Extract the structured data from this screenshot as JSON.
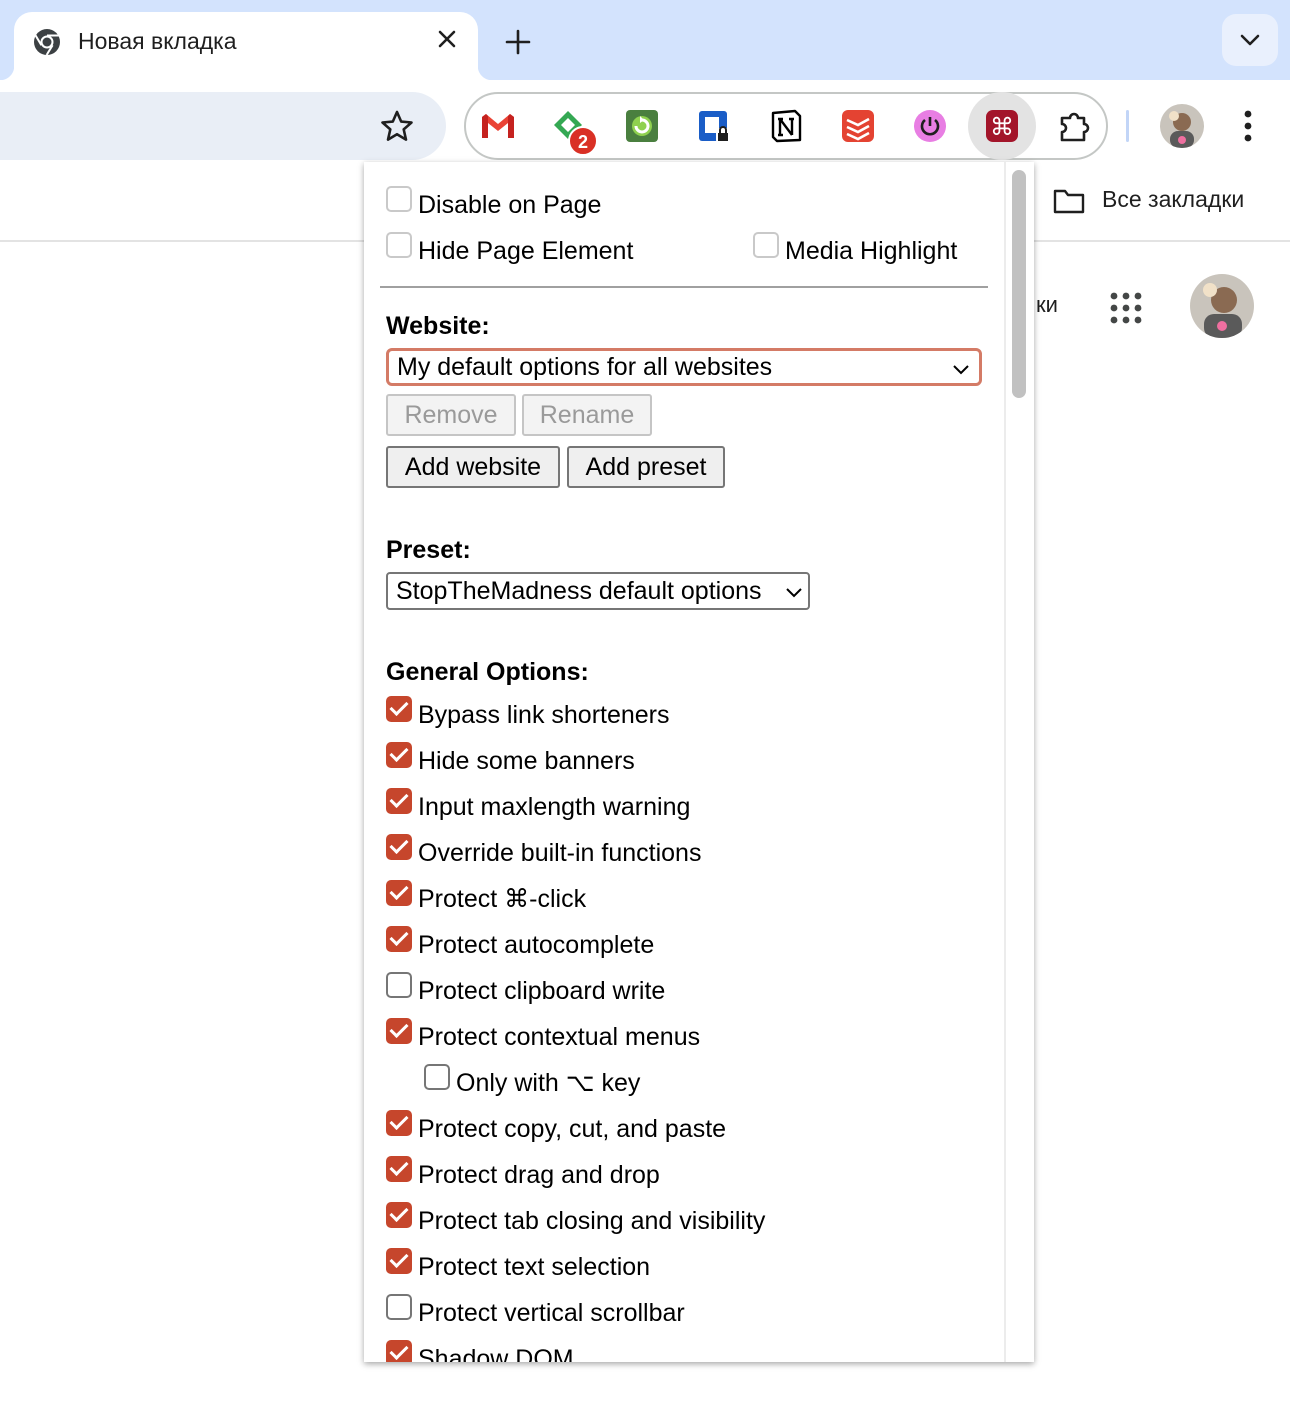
{
  "tab": {
    "title": "Новая вкладка"
  },
  "bookmarks": {
    "all_label": "Все закладки"
  },
  "page": {
    "partial_text": "ки"
  },
  "extensions": {
    "badge_count": "2"
  },
  "popup": {
    "disable_on_page": "Disable on Page",
    "hide_page_element": "Hide Page Element",
    "media_highlight": "Media Highlight",
    "website_heading": "Website:",
    "website_selected": "My default options for all websites",
    "remove_label": "Remove",
    "rename_label": "Rename",
    "add_website_label": "Add website",
    "add_preset_label": "Add preset",
    "preset_heading": "Preset:",
    "preset_selected": "StopTheMadness default options",
    "general_heading": "General Options:",
    "options": [
      {
        "label": "Bypass link shorteners",
        "checked": true
      },
      {
        "label": "Hide some banners",
        "checked": true
      },
      {
        "label": "Input maxlength warning",
        "checked": true
      },
      {
        "label": "Override built-in functions",
        "checked": true
      },
      {
        "label": "Protect ⌘-click",
        "checked": true
      },
      {
        "label": "Protect autocomplete",
        "checked": true
      },
      {
        "label": "Protect clipboard write",
        "checked": false
      },
      {
        "label": "Protect contextual menus",
        "checked": true
      },
      {
        "label": "Only with ⌥ key",
        "checked": false,
        "indent": true
      },
      {
        "label": "Protect copy, cut, and paste",
        "checked": true
      },
      {
        "label": "Protect drag and drop",
        "checked": true
      },
      {
        "label": "Protect tab closing and visibility",
        "checked": true
      },
      {
        "label": "Protect text selection",
        "checked": true
      },
      {
        "label": "Protect vertical scrollbar",
        "checked": false
      },
      {
        "label": "Shadow DOM",
        "checked": true
      }
    ]
  },
  "colors": {
    "accent": "#c6462c",
    "tabstrip": "#d3e3fd",
    "omnibox": "#e9eef6"
  }
}
